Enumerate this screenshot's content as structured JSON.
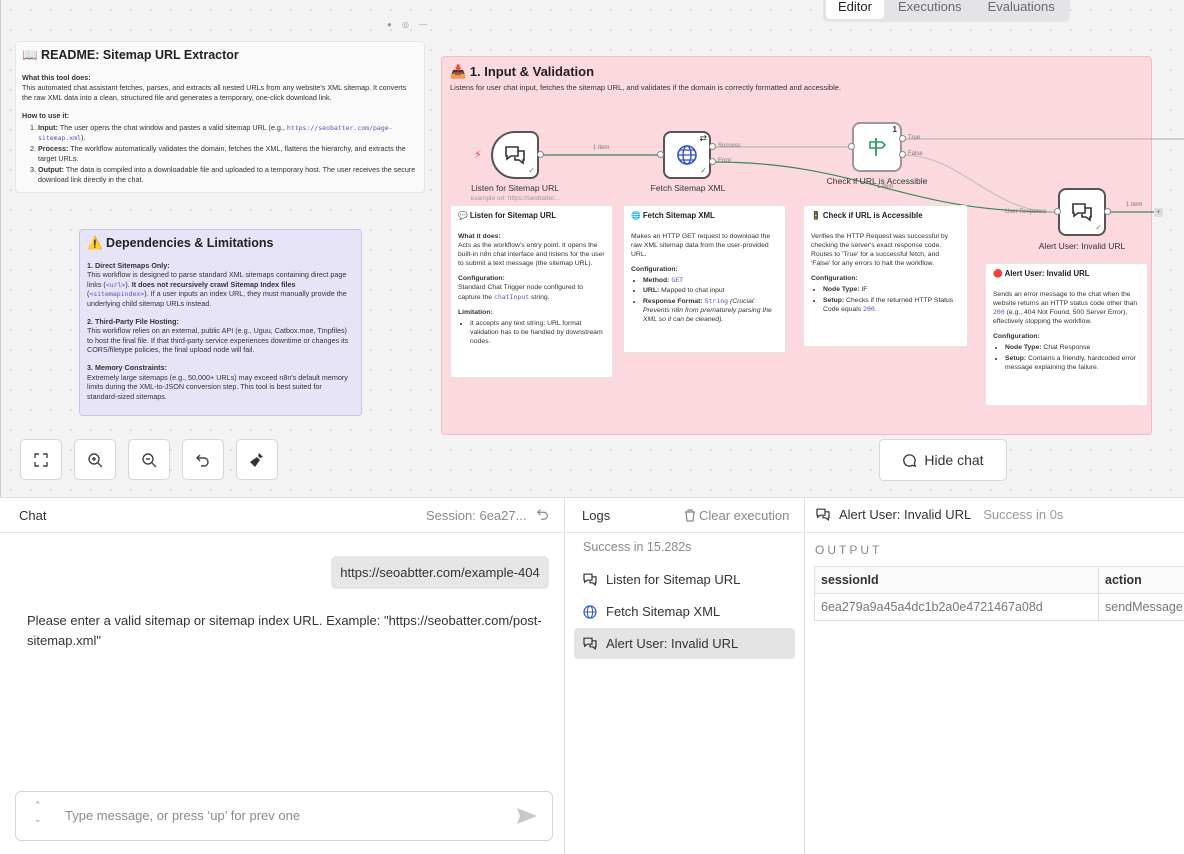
{
  "tabs": [
    {
      "label": "Editor",
      "active": true
    },
    {
      "label": "Executions",
      "active": false
    },
    {
      "label": "Evaluations",
      "active": false
    }
  ],
  "readme": {
    "title": "📖 README: Sitemap URL Extractor",
    "what_heading": "What this tool does:",
    "what_text": "This automated chat assistant fetches, parses, and extracts all nested URLs from any website's XML sitemap. It converts the raw XML data into a clean, structured file and generates a temporary, one-click download link.",
    "how_heading": "How to use it:",
    "step1_bold": "Input:",
    "step1_text": " The user opens the chat window and pastes a valid sitemap URL (e.g., ",
    "step1_code": "https://seobatter.com/page-sitemap.xml",
    "step1_end": ").",
    "step2_bold": "Process:",
    "step2_text": " The workflow automatically validates the domain, fetches the XML, flattens the hierarchy, and extracts the target URLs.",
    "step3_bold": "Output:",
    "step3_text": " The data is compiled into a downloadable file and uploaded to a temporary host. The user receives the secure download link directly in the chat."
  },
  "deps": {
    "title": "⚠️ Dependencies & Limitations",
    "s1_title": "1. Direct Sitemaps Only:",
    "s1_a": "This workflow is designed to parse standard XML sitemaps containing direct page links (",
    "s1_code1": "<url>",
    "s1_b": "). ",
    "s1_bold": "It does not recursively crawl Sitemap Index files",
    "s1_c": " (",
    "s1_code2": "<sitemapindex>",
    "s1_d": "). If a user inputs an index URL, they must manually provide the underlying child sitemap URLs instead.",
    "s2_title": "2. Third-Party File Hosting:",
    "s2_text": "This workflow relies on an external, public API (e.g., Uguu, Catbox.moe, Tmpfiles) to host the final file. If that third-party service experiences downtime or changes its CORS/filetype policies, the final upload node will fail.",
    "s3_title": "3. Memory Constraints:",
    "s3_text": "Extremely large sitemaps (e.g., 50,000+ URLs) may exceed n8n's default memory limits during the XML-to-JSON conversion step. This tool is best suited for standard-sized sitemaps."
  },
  "input_group": {
    "title": "📥 1. Input & Validation",
    "desc": "Listens for user chat input, fetches the sitemap URL, and validates if the domain is correctly formatted and accessible."
  },
  "nodes": {
    "listen": {
      "label": "Listen for Sitemap URL",
      "sub": "example url: https://seobatter..."
    },
    "fetch": {
      "label": "Fetch Sitemap XML"
    },
    "check": {
      "label": "Check if URL is Accessible",
      "badge": "1"
    },
    "alert": {
      "label": "Alert User: Invalid URL"
    },
    "conn_1item_a": "1 item",
    "conn_1item_b": "1 item",
    "conn_1item_c": "1 item",
    "port_success": "Success",
    "port_error": "Error",
    "port_true": "True",
    "port_false": "False",
    "port_user_response": "User Response"
  },
  "cards": {
    "listen": {
      "title": "💬 Listen for Sitemap URL",
      "what": "What it does:",
      "what_text": "Acts as the workflow's entry point. It opens the built-in n8n chat interface and listens for the user to submit a text message (the sitemap URL).",
      "config": "Configuration:",
      "config_a": "Standard Chat Trigger node configured to capture the ",
      "config_code": "chatInput",
      "config_b": " string.",
      "lim": "Limitation:",
      "lim_item": "It accepts any text string; URL format validation has to be handled by downstream nodes."
    },
    "fetch": {
      "title": "🌐 Fetch Sitemap XML",
      "text": "Makes an HTTP GET request to download the raw XML sitemap data from the user-provided URL.",
      "config": "Configuration:",
      "m_b": "Method:",
      "m_code": "GET",
      "u_b": "URL:",
      "u_t": " Mapped to chat input",
      "r_b": "Response Format:",
      "r_code": "String",
      "r_i": " (Crucial: Prevents n8n from prematurely parsing the XML so it can be cleaned)."
    },
    "check": {
      "title": "🚦 Check if URL is Accessible",
      "text": "Verifies the HTTP Request was successful by checking the server's exact response code. Routes to 'True' for a successful fetch, and 'False' for any errors to halt the workflow.",
      "config": "Configuration:",
      "nt_b": "Node Type:",
      "nt_t": " IF",
      "s_b": "Setup:",
      "s_t": " Checks if the returned HTTP Status Code equals ",
      "s_code": "200",
      "s_end": "."
    },
    "alert": {
      "title": "🔴 Alert User: Invalid URL",
      "text_a": "Sends an error message to the chat when the website returns an HTTP status code other than ",
      "text_code": "200",
      "text_b": " (e.g., 404 Not Found, 500 Server Error), effectively stopping the workflow.",
      "config": "Configuration:",
      "nt_b": "Node Type:",
      "nt_t": " Chat Response",
      "s_b": "Setup:",
      "s_t": " Contains a friendly, hardcoded error message explaining the failure."
    }
  },
  "canvas_controls": {
    "hide_chat": "Hide chat"
  },
  "chat": {
    "header": "Chat",
    "session": "Session: 6ea27...",
    "user_message": "https://seoabtter.com/example-404",
    "bot_message": "Please enter a valid sitemap or sitemap index URL. Example: \"https://seobatter.com/post-sitemap.xml\"",
    "input_placeholder": "Type message, or press ‘up’ for prev one"
  },
  "logs": {
    "header": "Logs",
    "clear": "Clear execution",
    "status": "Success in 15.282s",
    "items": [
      {
        "label": "Listen for Sitemap URL",
        "icon": "chat-icon"
      },
      {
        "label": "Fetch Sitemap XML",
        "icon": "globe-icon"
      },
      {
        "label": "Alert User: Invalid URL",
        "icon": "chat-icon",
        "selected": true
      }
    ]
  },
  "output": {
    "node": "Alert User: Invalid URL",
    "status": "Success in 0s",
    "label": "OUTPUT",
    "columns": [
      "sessionId",
      "action"
    ],
    "rows": [
      [
        "6ea279a9a45a4dc1b2a0e4721467a08d",
        "sendMessage"
      ]
    ]
  }
}
